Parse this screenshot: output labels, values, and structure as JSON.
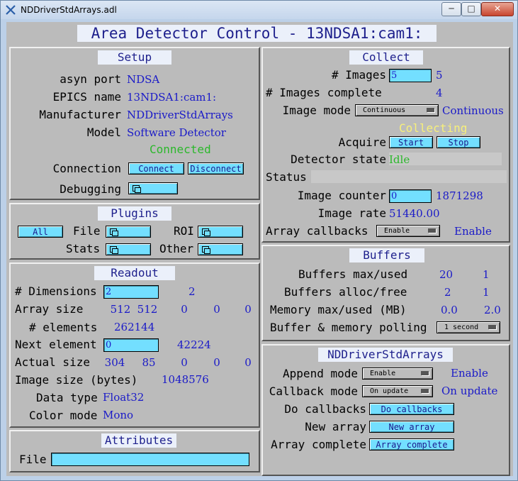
{
  "window": {
    "title": "NDDriverStdArrays.adl",
    "min": "─",
    "max": "□",
    "close": "✕"
  },
  "header": {
    "title": "Area Detector Control - 13NDSA1:cam1:"
  },
  "setup": {
    "title": "Setup",
    "asyn_port_label": "asyn port",
    "asyn_port": "NDSA",
    "epics_name_label": "EPICS name",
    "epics_name": "13NDSA1:cam1:",
    "manufacturer_label": "Manufacturer",
    "manufacturer": "NDDriverStdArrays",
    "model_label": "Model",
    "model": "Software Detector",
    "connected": "Connected",
    "connection_label": "Connection",
    "connect": "Connect",
    "disconnect": "Disconnect",
    "debugging_label": "Debugging"
  },
  "plugins": {
    "title": "Plugins",
    "all": "All",
    "file": "File",
    "roi": "ROI",
    "stats": "Stats",
    "other": "Other"
  },
  "readout": {
    "title": "Readout",
    "dimensions_label": "# Dimensions",
    "dimensions_input": "2",
    "dimensions": "2",
    "array_size_label": "Array size",
    "array_size": [
      "512",
      "512",
      "0",
      "0",
      "0"
    ],
    "elements_label": "# elements",
    "elements": "262144",
    "next_element_label": "Next element",
    "next_element_input": "0",
    "next_element": "42224",
    "actual_size_label": "Actual size",
    "actual_size": [
      "304",
      "85",
      "0",
      "0",
      "0"
    ],
    "image_size_label": "Image size (bytes)",
    "image_size": "1048576",
    "data_type_label": "Data type",
    "data_type": "Float32",
    "color_mode_label": "Color mode",
    "color_mode": "Mono"
  },
  "attributes": {
    "title": "Attributes",
    "file_label": "File",
    "file_value": ""
  },
  "collect": {
    "title": "Collect",
    "images_label": "# Images",
    "images_input": "5",
    "images": "5",
    "images_complete_label": "# Images complete",
    "images_complete": "4",
    "image_mode_label": "Image mode",
    "image_mode_select": "Continuous",
    "image_mode": "Continuous",
    "collecting": "Collecting",
    "acquire_label": "Acquire",
    "start": "Start",
    "stop": "Stop",
    "detector_state_label": "Detector state",
    "detector_state": "Idle",
    "status_label": "Status",
    "image_counter_label": "Image counter",
    "image_counter_input": "0",
    "image_counter": "1871298",
    "image_rate_label": "Image rate",
    "image_rate": "51440.00",
    "array_callbacks_label": "Array callbacks",
    "array_callbacks_select": "Enable",
    "array_callbacks": "Enable"
  },
  "buffers": {
    "title": "Buffers",
    "max_used_label": "Buffers max/used",
    "max": "20",
    "used": "1",
    "alloc_free_label": "Buffers alloc/free",
    "alloc": "2",
    "free": "1",
    "memory_label": "Memory max/used (MB)",
    "mem_max": "0.0",
    "mem_used": "2.0",
    "polling_label": "Buffer & memory polling",
    "polling": "1 second"
  },
  "ndsa": {
    "title": "NDDriverStdArrays",
    "append_mode_label": "Append mode",
    "append_mode_select": "Enable",
    "append_mode": "Enable",
    "callback_mode_label": "Callback mode",
    "callback_mode_select": "On update",
    "callback_mode": "On update",
    "do_callbacks_label": "Do callbacks",
    "do_callbacks": "Do callbacks",
    "new_array_label": "New array",
    "new_array": "New array",
    "array_complete_label": "Array complete",
    "array_complete": "Array complete"
  }
}
